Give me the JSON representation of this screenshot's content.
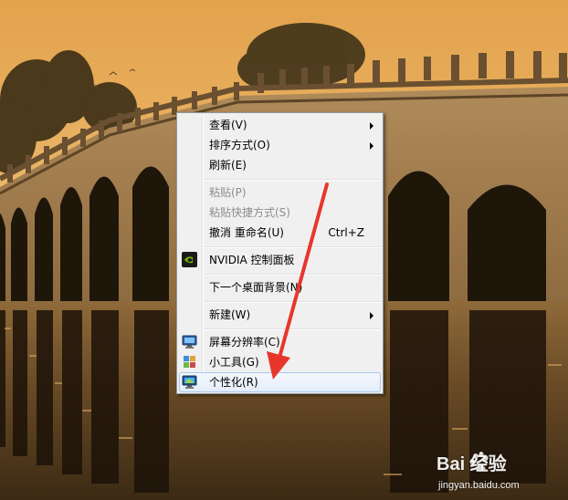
{
  "menu": {
    "items": [
      {
        "label": "查看(V)",
        "submenu": true
      },
      {
        "label": "排序方式(O)",
        "submenu": true
      },
      {
        "label": "刷新(E)"
      },
      {
        "label": "粘贴(P)",
        "disabled": true
      },
      {
        "label": "粘贴快捷方式(S)",
        "disabled": true
      },
      {
        "label": "撤消 重命名(U)",
        "shortcut": "Ctrl+Z"
      },
      {
        "label": "NVIDIA 控制面板",
        "icon": "nvidia-icon"
      },
      {
        "label": "下一个桌面背景(N)"
      },
      {
        "label": "新建(W)",
        "submenu": true
      },
      {
        "label": "屏幕分辨率(C)",
        "icon": "monitor-icon"
      },
      {
        "label": "小工具(G)",
        "icon": "gadgets-icon"
      },
      {
        "label": "个性化(R)",
        "icon": "personalize-icon",
        "highlighted": true
      }
    ]
  },
  "watermark": {
    "brand": "Bai 经验",
    "url": "jingyan.baidu.com"
  },
  "colors": {
    "annotation_arrow": "#e8362d",
    "menu_background": "#f0f0f0",
    "highlight_border": "#a8c7ed"
  }
}
